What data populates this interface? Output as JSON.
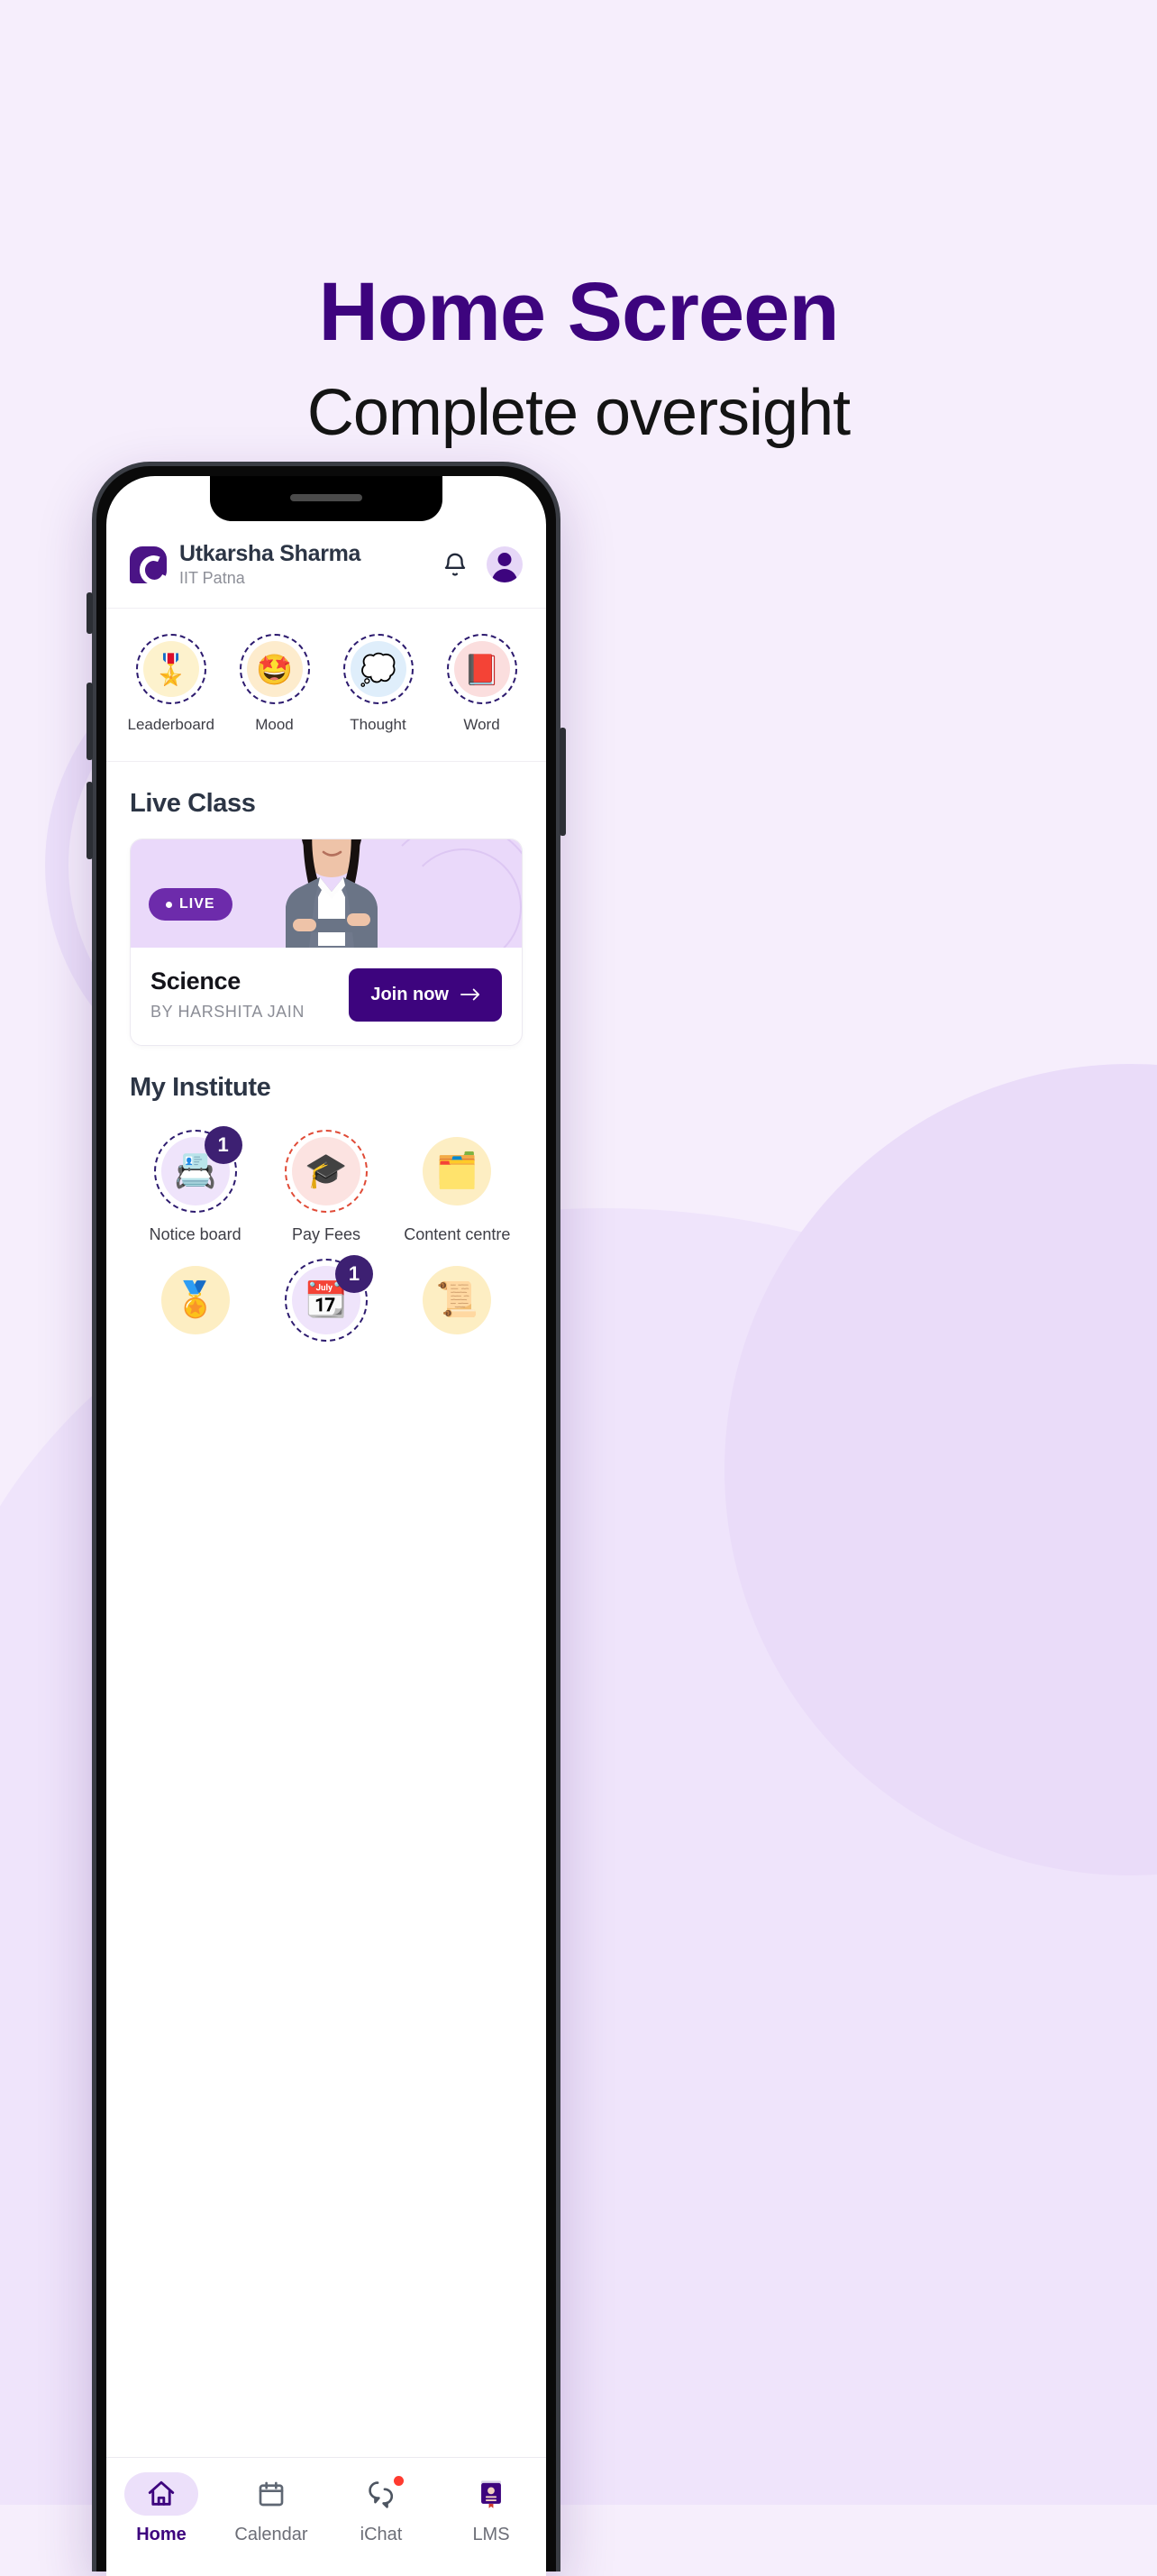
{
  "promo": {
    "title": "Home Screen",
    "subtitle": "Complete oversight",
    "title_color": "#3d047e",
    "subtitle_color": "#141414",
    "background_color": "#f6eefc"
  },
  "app": {
    "header": {
      "logo_icon": "brand-droplet-c-logo",
      "user_name": "Utkarsha Sharma",
      "institute": "IIT Patna",
      "bell_icon": "bell-icon",
      "avatar_icon": "avatar-person-icon"
    },
    "quick_actions": [
      {
        "label": "Leaderboard",
        "icon": "rosette-medal-icon",
        "emoji": "🎖️",
        "bg": "#fdf2cd",
        "ring": "#2c1a6e"
      },
      {
        "label": "Mood",
        "icon": "star-struck-face-icon",
        "emoji": "🤩",
        "bg": "#fdeccd",
        "ring": "#2c1a6e"
      },
      {
        "label": "Thought",
        "icon": "thought-bubble-icon",
        "emoji": "💭",
        "bg": "#dfeefb",
        "ring": "#2c1a6e"
      },
      {
        "label": "Word",
        "icon": "closed-book-icon",
        "emoji": "📕",
        "bg": "#fbdede",
        "ring": "#2c1a6e"
      }
    ],
    "live_class": {
      "section_title": "Live Class",
      "badge_label": "LIVE",
      "course": "Science",
      "teacher": "BY HARSHITA JAIN",
      "join_label": "Join now",
      "join_icon": "arrow-right-icon",
      "media_bg": "#ead9fa",
      "badge_color": "#6d2bab",
      "join_color": "#3d047e"
    },
    "my_institute": {
      "section_title": "My Institute",
      "items": [
        {
          "label": "Notice board",
          "icon": "pinboard-notes-icon",
          "emoji": "📇",
          "bg": "#efe4fb",
          "ring": "#2c1a6e",
          "ring_style": "dashed",
          "badge": "1"
        },
        {
          "label": "Pay Fees",
          "icon": "graduation-cap-icon",
          "emoji": "🎓",
          "bg": "#fce3e1",
          "ring": "#e04a36",
          "ring_style": "dashed",
          "badge": ""
        },
        {
          "label": "Content centre",
          "icon": "document-media-icon",
          "emoji": "🗂️",
          "bg": "#fdeec3",
          "ring": "",
          "ring_style": "none",
          "badge": ""
        },
        {
          "label": "",
          "icon": "award-rosette-icon",
          "emoji": "🏅",
          "bg": "#fdeec3",
          "ring": "",
          "ring_style": "none",
          "badge": ""
        },
        {
          "label": "",
          "icon": "calendar-exam-icon",
          "emoji": "📆",
          "bg": "#efe4fb",
          "ring": "#2c1a6e",
          "ring_style": "dashed",
          "badge": "1"
        },
        {
          "label": "",
          "icon": "certificate-award-icon",
          "emoji": "📜",
          "bg": "#fdeec3",
          "ring": "",
          "ring_style": "none",
          "badge": ""
        }
      ]
    },
    "bottom_nav": {
      "active": "Home",
      "items": [
        {
          "label": "Home",
          "icon": "home-icon",
          "dot": false
        },
        {
          "label": "Calendar",
          "icon": "calendar-icon",
          "dot": false
        },
        {
          "label": "iChat",
          "icon": "chat-bubbles-icon",
          "dot": true
        },
        {
          "label": "LMS",
          "icon": "book-icon",
          "dot": false
        }
      ]
    }
  }
}
